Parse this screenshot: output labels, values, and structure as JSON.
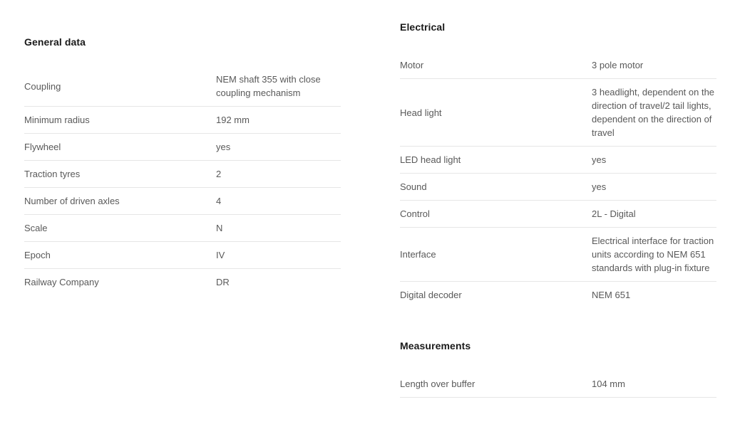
{
  "page": {
    "background_color": "#ffffff",
    "text_color": "#595959",
    "heading_color": "#1a1a1a",
    "rule_color": "#e6e6e6"
  },
  "sections": {
    "general_data": {
      "title": "General data",
      "rows": [
        {
          "label": "Coupling",
          "value": "NEM shaft 355 with close coupling mechanism"
        },
        {
          "label": "Minimum radius",
          "value": "192 mm"
        },
        {
          "label": "Flywheel",
          "value": "yes"
        },
        {
          "label": "Traction tyres",
          "value": "2"
        },
        {
          "label": "Number of driven axles",
          "value": "4"
        },
        {
          "label": "Scale",
          "value": "N"
        },
        {
          "label": "Epoch",
          "value": "IV"
        },
        {
          "label": "Railway Company",
          "value": "DR"
        }
      ]
    },
    "electrical": {
      "title": "Electrical",
      "rows": [
        {
          "label": "Motor",
          "value": "3 pole motor"
        },
        {
          "label": "Head light",
          "value": "3 headlight, dependent on the direction of travel/2 tail lights, dependent on the direction of travel"
        },
        {
          "label": "LED head light",
          "value": "yes"
        },
        {
          "label": "Sound",
          "value": "yes"
        },
        {
          "label": "Control",
          "value": "2L - Digital"
        },
        {
          "label": "Interface",
          "value": "Electrical interface for traction units according to NEM 651 standards with plug-in fixture"
        },
        {
          "label": "Digital decoder",
          "value": "NEM 651"
        }
      ]
    },
    "measurements": {
      "title": "Measurements",
      "rows": [
        {
          "label": "Length over buffer",
          "value": "104 mm"
        }
      ]
    }
  }
}
